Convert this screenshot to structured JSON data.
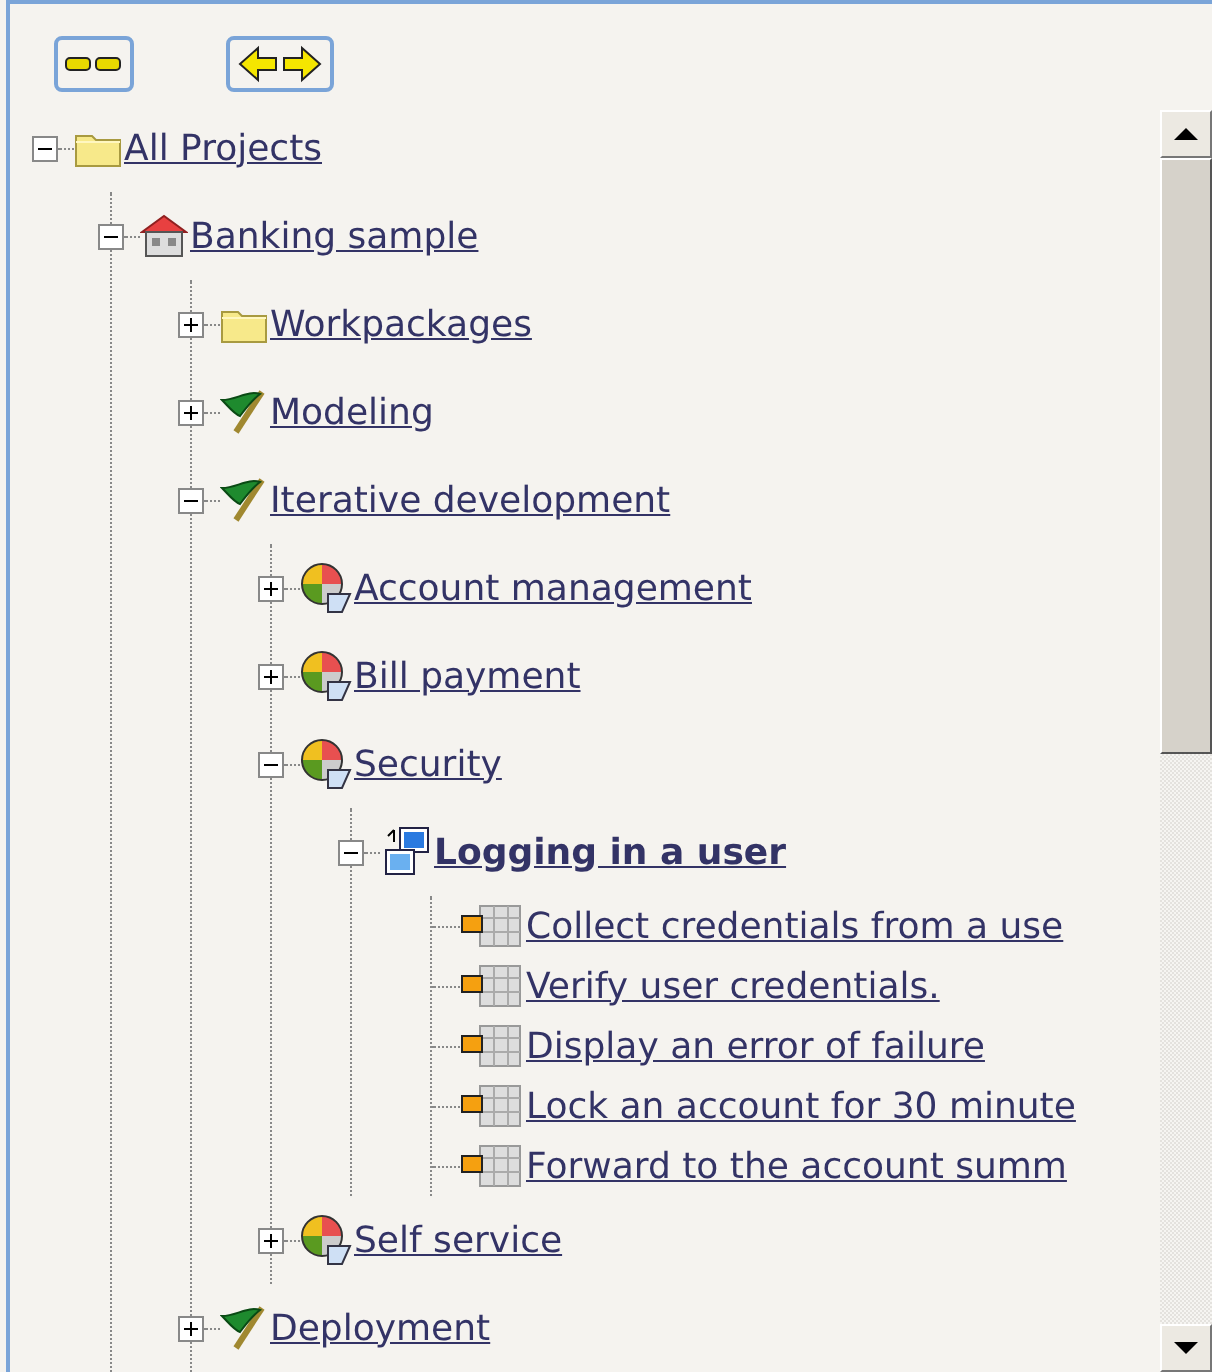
{
  "toolbar": {
    "buttons": [
      {
        "kind": "collapse"
      },
      {
        "kind": "expand"
      }
    ]
  },
  "tree": [
    {
      "kind": "folder",
      "label": "All Projects",
      "expanded": true,
      "children": [
        {
          "kind": "project",
          "label": "Banking sample",
          "expanded": true,
          "children": [
            {
              "kind": "folder",
              "label": "Workpackages",
              "expanded": false
            },
            {
              "kind": "flag",
              "label": "Modeling",
              "expanded": false
            },
            {
              "kind": "flag",
              "label": "Iterative development",
              "expanded": true,
              "children": [
                {
                  "kind": "usecase",
                  "label": "Account management",
                  "expanded": false
                },
                {
                  "kind": "usecase",
                  "label": "Bill payment",
                  "expanded": false
                },
                {
                  "kind": "usecase",
                  "label": "Security",
                  "expanded": true,
                  "children": [
                    {
                      "kind": "scenario",
                      "label": "Logging in a user",
                      "expanded": true,
                      "children": [
                        {
                          "kind": "step",
                          "label": "Collect credentials from a use"
                        },
                        {
                          "kind": "step",
                          "label": "Verify user credentials."
                        },
                        {
                          "kind": "step",
                          "label": "Display an error of failure"
                        },
                        {
                          "kind": "step",
                          "label": "Lock an account for 30 minute"
                        },
                        {
                          "kind": "step",
                          "label": "Forward to the account summ"
                        }
                      ]
                    }
                  ]
                },
                {
                  "kind": "usecase",
                  "label": "Self service",
                  "expanded": false
                }
              ]
            },
            {
              "kind": "flag",
              "label": "Deployment",
              "expanded": false
            }
          ]
        }
      ]
    }
  ]
}
